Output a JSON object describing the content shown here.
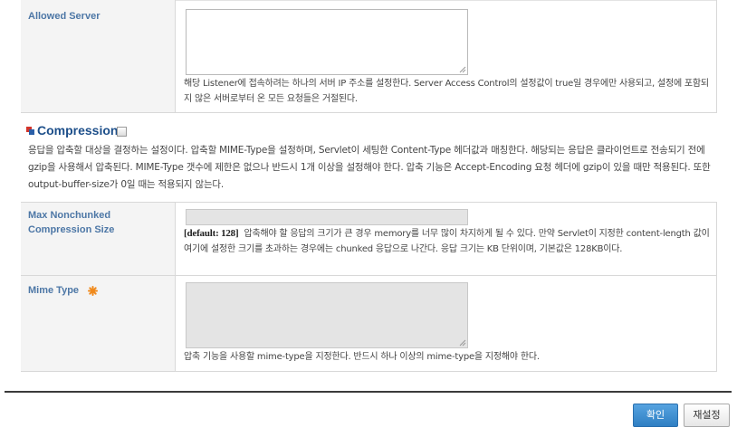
{
  "allowed_server": {
    "label": "Allowed Server",
    "description": "해당 Listener에 접속하려는 하나의 서버 IP 주소를 설정한다. Server Access Control의 설정값이 true일 경우에만 사용되고, 설정에 포함되지 않은 서버로부터 온 모든 요청들은 거절된다."
  },
  "compression": {
    "title": "Compression",
    "checked": false,
    "description": "응답을 압축할 대상을 결정하는 설정이다. 압축할 MIME-Type을 설정하며, Servlet이 세팅한 Content-Type 헤더값과 매칭한다. 해당되는 응답은 클라이언트로 전송되기 전에 gzip을 사용해서 압축된다. MIME-Type 갯수에 제한은 없으나 반드시 1개 이상을 설정해야 한다. 압축 기능은 Accept-Encoding 요청 헤더에 gzip이 있을 때만 적용된다. 또한 output-buffer-size가 0일 때는 적용되지 않는다."
  },
  "max_nonchunked": {
    "label_line1": "Max Nonchunked",
    "label_line2": "Compression Size",
    "default_tag": "[default: 128]",
    "description": "압축해야 할 응답의 크기가 큰 경우 memory를 너무 많이 차지하게 될 수 있다. 만약 Servlet이 지정한 content-length 값이 여기에 설정한 크기를 초과하는 경우에는 chunked 응답으로 나간다. 응답 크기는 KB 단위이며, 기본값은 128KB이다."
  },
  "mime_type": {
    "label": "Mime Type",
    "required_icon": "required-asterisk-icon",
    "description": "압축 기능을 사용할 mime-type을 지정한다. 반드시 하나 이상의 mime-type을 지정해야 한다."
  },
  "buttons": {
    "confirm": "확인",
    "reset": "재설정"
  },
  "colors": {
    "label": "#4d77a6",
    "confirm_bg": "#3f8ed0",
    "panel_bg": "#f4f4f4"
  }
}
